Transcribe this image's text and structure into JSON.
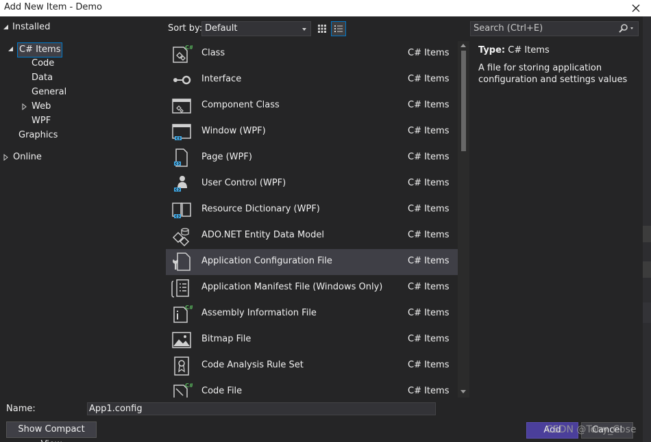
{
  "window": {
    "title": "Add New Item - Demo",
    "close_glyph": "✕"
  },
  "tree": {
    "installed": "Installed",
    "csharp_items": "C# Items",
    "code": "Code",
    "data": "Data",
    "general": "General",
    "web": "Web",
    "wpf": "WPF",
    "graphics": "Graphics",
    "online": "Online"
  },
  "toolbar": {
    "sort_label": "Sort by:",
    "sort_value": "Default",
    "search_placeholder": "Search (Ctrl+E)"
  },
  "items": [
    {
      "name": "Class",
      "category": "C# Items",
      "icon": "class-icon"
    },
    {
      "name": "Interface",
      "category": "C# Items",
      "icon": "interface-icon"
    },
    {
      "name": "Component Class",
      "category": "C# Items",
      "icon": "component-class-icon"
    },
    {
      "name": "Window (WPF)",
      "category": "C# Items",
      "icon": "window-icon"
    },
    {
      "name": "Page (WPF)",
      "category": "C# Items",
      "icon": "page-icon"
    },
    {
      "name": "User Control (WPF)",
      "category": "C# Items",
      "icon": "user-control-icon"
    },
    {
      "name": "Resource Dictionary (WPF)",
      "category": "C# Items",
      "icon": "resource-dictionary-icon"
    },
    {
      "name": "ADO.NET Entity Data Model",
      "category": "C# Items",
      "icon": "entity-model-icon"
    },
    {
      "name": "Application Configuration File",
      "category": "C# Items",
      "icon": "config-file-icon"
    },
    {
      "name": "Application Manifest File (Windows Only)",
      "category": "C# Items",
      "icon": "manifest-file-icon"
    },
    {
      "name": "Assembly Information File",
      "category": "C# Items",
      "icon": "assembly-info-icon"
    },
    {
      "name": "Bitmap File",
      "category": "C# Items",
      "icon": "bitmap-icon"
    },
    {
      "name": "Code Analysis Rule Set",
      "category": "C# Items",
      "icon": "rule-set-icon"
    },
    {
      "name": "Code File",
      "category": "C# Items",
      "icon": "code-file-icon"
    }
  ],
  "selected_index": 8,
  "info": {
    "type_label": "Type:",
    "type_value": "C# Items",
    "description": "A file for storing application configuration and settings values"
  },
  "bottom": {
    "name_label": "Name:",
    "name_value": "App1.config",
    "compact_view": "Show Compact View",
    "add": "Add",
    "cancel": "Cancel",
    "watermark": "CSDN @Tony_Cose"
  },
  "colors": {
    "background": "#252526",
    "selection": "#3f3f46",
    "accent": "#007acc",
    "primary_button": "#4b3f9b",
    "icon_blue": "#3ea7e4",
    "icon_green": "#57b25b"
  }
}
